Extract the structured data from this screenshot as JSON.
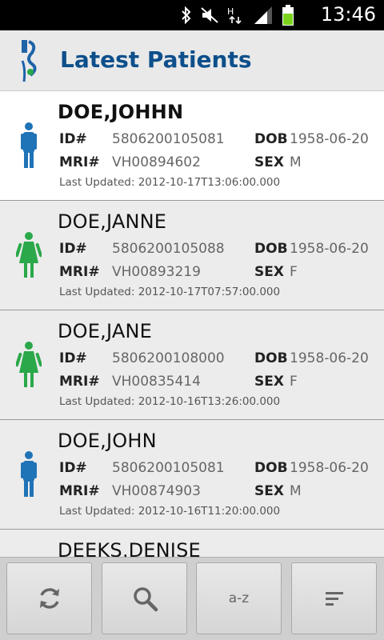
{
  "status_bar": {
    "time": "13:46"
  },
  "header": {
    "title": "Latest Patients"
  },
  "labels": {
    "id": "ID#",
    "mri": "MRI#",
    "dob": "DOB",
    "sex": "SEX",
    "last_updated": "Last Updated:"
  },
  "patients": [
    {
      "name": "DOE,JOHHN",
      "id": "5806200105081",
      "mri": "VH00894602",
      "dob": "1958-06-20",
      "sex": "M",
      "updated": "2012-10-17T13:06:00.000",
      "gender_icon": "male-icon"
    },
    {
      "name": "DOE,JANNE",
      "id": "5806200105088",
      "mri": "VH00893219",
      "dob": "1958-06-20",
      "sex": "F",
      "updated": "2012-10-17T07:57:00.000",
      "gender_icon": "female-icon"
    },
    {
      "name": "DOE,JANE",
      "id": "5806200108000",
      "mri": "VH00835414",
      "dob": "1958-06-20",
      "sex": "F",
      "updated": "2012-10-16T13:26:00.000",
      "gender_icon": "female-icon"
    },
    {
      "name": "DOE,JOHN",
      "id": "5806200105081",
      "mri": "VH00874903",
      "dob": "1958-06-20",
      "sex": "M",
      "updated": "2012-10-16T11:20:00.000",
      "gender_icon": "male-icon"
    },
    {
      "name": "DEEKS,DENISE"
    }
  ],
  "toolbar": {
    "sort_az_label": "a-z"
  },
  "colors": {
    "male": "#1f73b7",
    "female": "#2aa84a",
    "title": "#0d4f8b"
  }
}
